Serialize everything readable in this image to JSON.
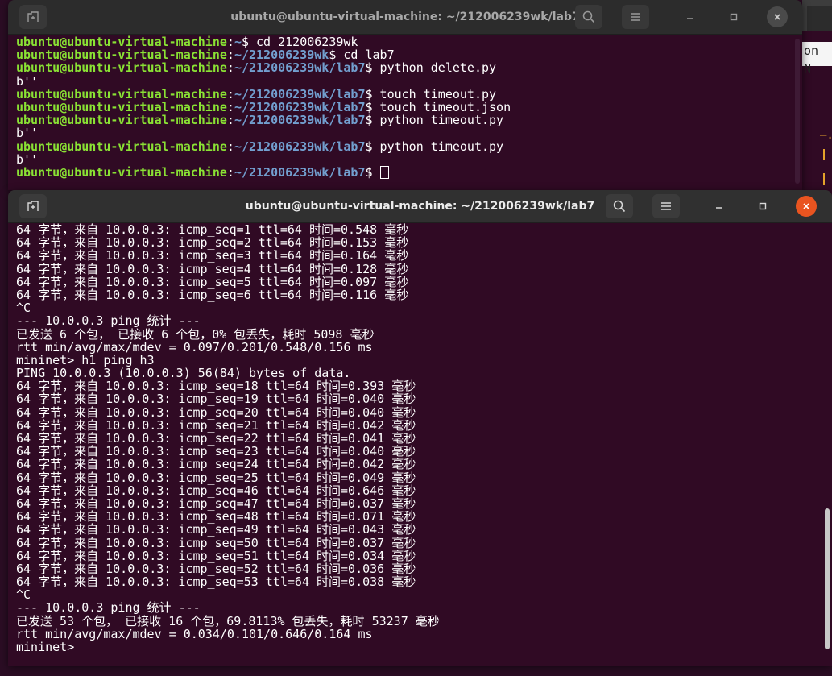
{
  "background_window": {
    "title": "ubuntu@ubuntu-virtual-machine: ~/212006239wk/lab7",
    "lines": [
      {
        "user": "ubuntu@ubuntu-virtual-machine",
        "sep": ":",
        "path": "~",
        "cmd": "$ cd 212006239wk"
      },
      {
        "user": "ubuntu@ubuntu-virtual-machine",
        "sep": ":",
        "path": "~/212006239wk",
        "cmd": "$ cd lab7"
      },
      {
        "user": "ubuntu@ubuntu-virtual-machine",
        "sep": ":",
        "path": "~/212006239wk/lab7",
        "cmd": "$ python delete.py"
      },
      {
        "text": "b''"
      },
      {
        "user": "ubuntu@ubuntu-virtual-machine",
        "sep": ":",
        "path": "~/212006239wk/lab7",
        "cmd": "$ touch timeout.py"
      },
      {
        "user": "ubuntu@ubuntu-virtual-machine",
        "sep": ":",
        "path": "~/212006239wk/lab7",
        "cmd": "$ touch timeout.json"
      },
      {
        "user": "ubuntu@ubuntu-virtual-machine",
        "sep": ":",
        "path": "~/212006239wk/lab7",
        "cmd": "$ python timeout.py"
      },
      {
        "text": "b''"
      },
      {
        "user": "ubuntu@ubuntu-virtual-machine",
        "sep": ":",
        "path": "~/212006239wk/lab7",
        "cmd": "$ python timeout.py"
      },
      {
        "text": "b''"
      },
      {
        "user": "ubuntu@ubuntu-virtual-machine",
        "sep": ":",
        "path": "~/212006239wk/lab7",
        "cmd": "$ ",
        "cursor": true
      }
    ]
  },
  "foreground_window": {
    "title": "ubuntu@ubuntu-virtual-machine: ~/212006239wk/lab7",
    "lines": [
      "64 字节，来自 10.0.0.3: icmp_seq=1 ttl=64 时间=0.548 毫秒",
      "64 字节，来自 10.0.0.3: icmp_seq=2 ttl=64 时间=0.153 毫秒",
      "64 字节，来自 10.0.0.3: icmp_seq=3 ttl=64 时间=0.164 毫秒",
      "64 字节，来自 10.0.0.3: icmp_seq=4 ttl=64 时间=0.128 毫秒",
      "64 字节，来自 10.0.0.3: icmp_seq=5 ttl=64 时间=0.097 毫秒",
      "64 字节，来自 10.0.0.3: icmp_seq=6 ttl=64 时间=0.116 毫秒",
      "^C",
      "--- 10.0.0.3 ping 统计 ---",
      "已发送 6 个包， 已接收 6 个包，0% 包丢失，耗时 5098 毫秒",
      "rtt min/avg/max/mdev = 0.097/0.201/0.548/0.156 ms",
      "mininet> h1 ping h3",
      "PING 10.0.0.3 (10.0.0.3) 56(84) bytes of data.",
      "64 字节，来自 10.0.0.3: icmp_seq=18 ttl=64 时间=0.393 毫秒",
      "64 字节，来自 10.0.0.3: icmp_seq=19 ttl=64 时间=0.040 毫秒",
      "64 字节，来自 10.0.0.3: icmp_seq=20 ttl=64 时间=0.040 毫秒",
      "64 字节，来自 10.0.0.3: icmp_seq=21 ttl=64 时间=0.042 毫秒",
      "64 字节，来自 10.0.0.3: icmp_seq=22 ttl=64 时间=0.041 毫秒",
      "64 字节，来自 10.0.0.3: icmp_seq=23 ttl=64 时间=0.040 毫秒",
      "64 字节，来自 10.0.0.3: icmp_seq=24 ttl=64 时间=0.042 毫秒",
      "64 字节，来自 10.0.0.3: icmp_seq=25 ttl=64 时间=0.049 毫秒",
      "64 字节，来自 10.0.0.3: icmp_seq=46 ttl=64 时间=0.646 毫秒",
      "64 字节，来自 10.0.0.3: icmp_seq=47 ttl=64 时间=0.037 毫秒",
      "64 字节，来自 10.0.0.3: icmp_seq=48 ttl=64 时间=0.071 毫秒",
      "64 字节，来自 10.0.0.3: icmp_seq=49 ttl=64 时间=0.043 毫秒",
      "64 字节，来自 10.0.0.3: icmp_seq=50 ttl=64 时间=0.037 毫秒",
      "64 字节，来自 10.0.0.3: icmp_seq=51 ttl=64 时间=0.034 毫秒",
      "64 字节，来自 10.0.0.3: icmp_seq=52 ttl=64 时间=0.036 毫秒",
      "64 字节，来自 10.0.0.3: icmp_seq=53 ttl=64 时间=0.038 毫秒",
      "^C",
      "--- 10.0.0.3 ping 统计 ---",
      "已发送 53 个包， 已接收 16 个包，69.8113% 包丢失，耗时 53237 毫秒",
      "rtt min/avg/max/mdev = 0.034/0.101/0.646/0.164 ms",
      "mininet>"
    ]
  },
  "right_window_fragment": {
    "text": "on N"
  },
  "colors": {
    "terminal_bg": "#300a24",
    "prompt_user": "#8ae234",
    "prompt_path": "#729fcf",
    "close_button": "#e95420",
    "titlebar": "#303030"
  },
  "icons": [
    "new-tab-icon",
    "search-icon",
    "menu-icon",
    "minimize-icon",
    "maximize-icon",
    "close-icon"
  ]
}
